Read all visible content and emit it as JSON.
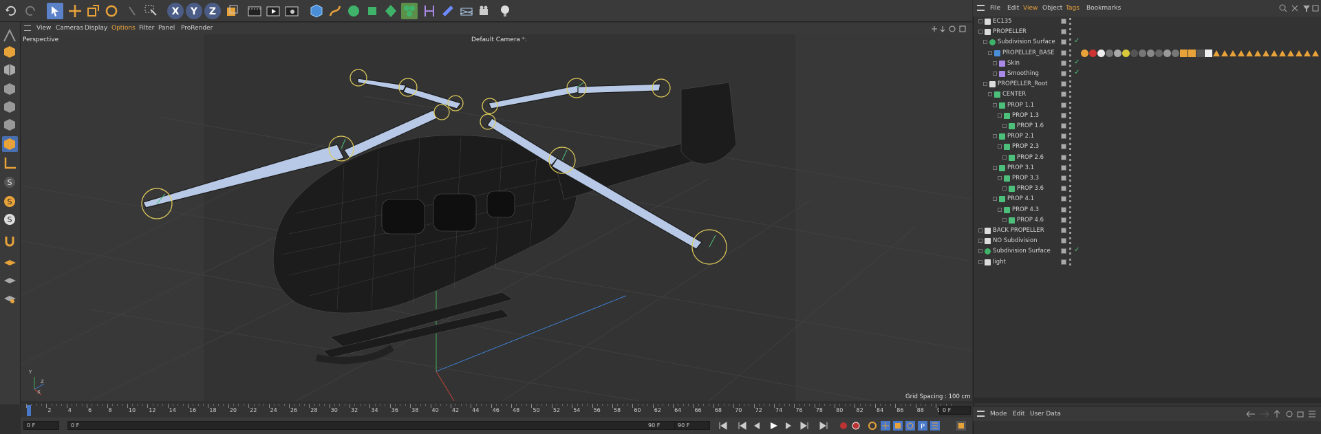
{
  "viewport_menu": [
    "View",
    "Cameras",
    "Display",
    "Options",
    "Filter",
    "Panel",
    "ProRender"
  ],
  "viewport_label": "Perspective",
  "camera_label": "Default Camera",
  "camera_suffix": "*:",
  "grid_spacing": "Grid Spacing : 100 cm",
  "axis_labels": {
    "y": "Y",
    "z": "Z",
    "x": "X"
  },
  "timeline_ticks": [
    "0",
    "2",
    "4",
    "6",
    "8",
    "10",
    "12",
    "14",
    "16",
    "18",
    "20",
    "22",
    "24",
    "26",
    "28",
    "30",
    "32",
    "34",
    "36",
    "38",
    "40",
    "42",
    "44",
    "46",
    "48",
    "50",
    "52",
    "54",
    "56",
    "58",
    "60",
    "62",
    "64",
    "66",
    "68",
    "70",
    "72",
    "74",
    "76",
    "78",
    "80",
    "82",
    "84",
    "86",
    "88",
    "90"
  ],
  "timeline_current_field": "0 F",
  "bottom_fields": {
    "start": "0 F",
    "current": "0 F",
    "end_a": "90 F",
    "end_b": "90 F"
  },
  "object_menu": [
    "File",
    "Edit",
    "View",
    "Object",
    "Tags",
    "Bookmarks"
  ],
  "attr_menu": [
    "Mode",
    "Edit",
    "User Data"
  ],
  "objects": [
    {
      "name": "EC135",
      "indent": 0,
      "icon": "null"
    },
    {
      "name": "PROPELLER",
      "indent": 0,
      "icon": "null"
    },
    {
      "name": "Subdivision Surface",
      "indent": 1,
      "icon": "subd",
      "check": true
    },
    {
      "name": "PROPELLER_BASE",
      "indent": 2,
      "icon": "poly",
      "tags": true
    },
    {
      "name": "Skin",
      "indent": 3,
      "icon": "skin",
      "check": true
    },
    {
      "name": "Smoothing",
      "indent": 3,
      "icon": "smooth",
      "check": true
    },
    {
      "name": "PROPELLER_Root",
      "indent": 1,
      "icon": "null"
    },
    {
      "name": "CENTER",
      "indent": 2,
      "icon": "joint"
    },
    {
      "name": "PROP 1.1",
      "indent": 3,
      "icon": "joint"
    },
    {
      "name": "PROP 1.3",
      "indent": 4,
      "icon": "joint"
    },
    {
      "name": "PROP 1.6",
      "indent": 5,
      "icon": "joint"
    },
    {
      "name": "PROP 2.1",
      "indent": 3,
      "icon": "joint"
    },
    {
      "name": "PROP 2.3",
      "indent": 4,
      "icon": "joint"
    },
    {
      "name": "PROP 2.6",
      "indent": 5,
      "icon": "joint"
    },
    {
      "name": "PROP 3.1",
      "indent": 3,
      "icon": "joint"
    },
    {
      "name": "PROP 3.3",
      "indent": 4,
      "icon": "joint"
    },
    {
      "name": "PROP 3.6",
      "indent": 5,
      "icon": "joint"
    },
    {
      "name": "PROP 4.1",
      "indent": 3,
      "icon": "joint"
    },
    {
      "name": "PROP 4.3",
      "indent": 4,
      "icon": "joint"
    },
    {
      "name": "PROP 4.6",
      "indent": 5,
      "icon": "joint"
    },
    {
      "name": "BACK PROPELLER",
      "indent": 0,
      "icon": "null"
    },
    {
      "name": "NO Subdivision",
      "indent": 0,
      "icon": "null"
    },
    {
      "name": "Subdivision Surface",
      "indent": 0,
      "icon": "subd",
      "check": true
    },
    {
      "name": "light",
      "indent": 0,
      "icon": "null"
    }
  ],
  "colors": {
    "accent_orange": "#e8a23a",
    "selection_blue": "#4a78c8",
    "joint_green": "#4cc07a",
    "blade": "#b7c9e6"
  }
}
